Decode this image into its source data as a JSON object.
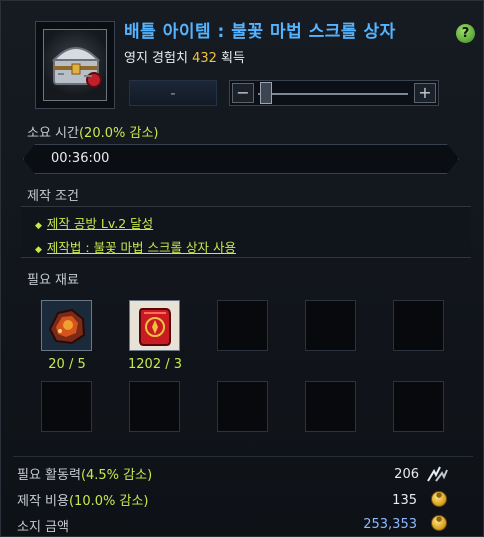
{
  "header": {
    "title": "배틀 아이템 : 불꽃 마법 스크롤 상자",
    "exp_prefix": "영지 경험치 ",
    "exp_value": "432",
    "exp_suffix": " 획득",
    "help_label": "?"
  },
  "quantity": {
    "minus_label": "-",
    "decrease_label": "−",
    "increase_label": "+",
    "slider_level": 0
  },
  "time": {
    "label": "소요 시간",
    "discount": "(20.0% 감소)",
    "value": "00:36:00"
  },
  "conditions": {
    "label": "제작 조건",
    "items": [
      "제작 공방 Lv.2 달성",
      "제작법 : 불꽃 마법 스크롤 상자 사용"
    ]
  },
  "materials": {
    "label": "필요 재료",
    "items": [
      {
        "icon": "fire-ore-icon",
        "qty": "20 / 5"
      },
      {
        "icon": "fire-scroll-icon",
        "qty": "1202 / 3"
      }
    ]
  },
  "costs": {
    "energy_label": "필요 활동력",
    "energy_discount": "(4.5% 감소)",
    "energy_value": "206",
    "cost_label": "제작 비용",
    "cost_discount": "(10.0% 감소)",
    "cost_value": "135",
    "owned_label": "소지 금액",
    "owned_value": "253,353"
  },
  "colors": {
    "title": "#55b4ff",
    "highlight": "#c7e84e",
    "exp_number": "#f2c23a",
    "money": "#8cb8ff"
  }
}
